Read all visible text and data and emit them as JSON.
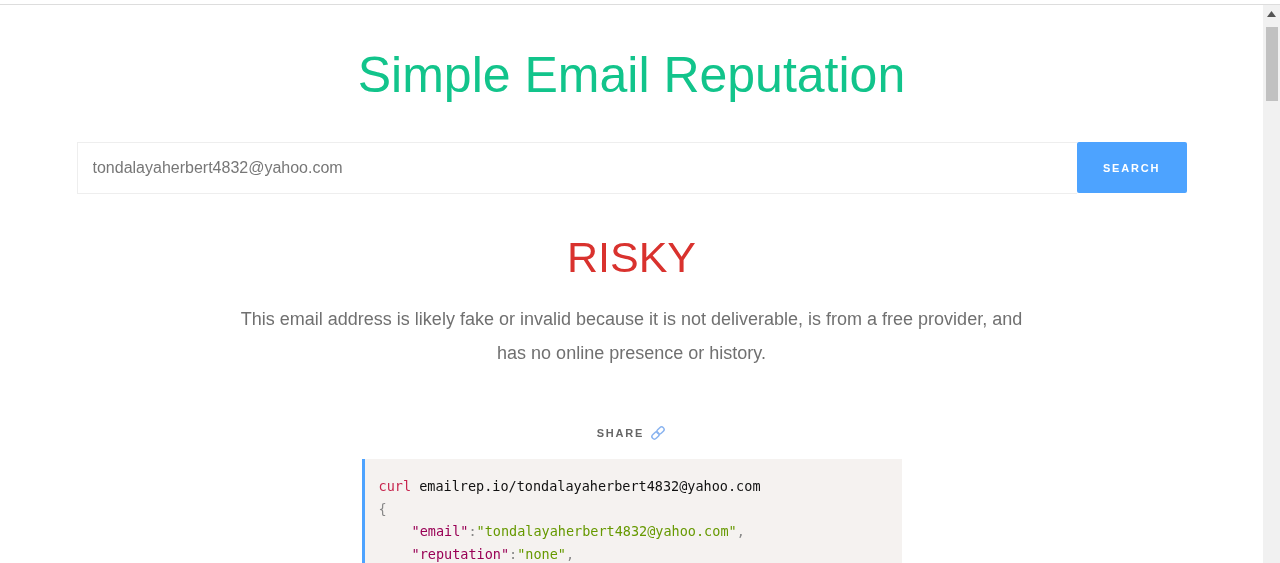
{
  "title": "Simple Email Reputation",
  "search": {
    "value": "tondalayaherbert4832@yahoo.com",
    "button": "SEARCH"
  },
  "verdict": {
    "label": "RISKY",
    "kind": "risky"
  },
  "summary": "This email address is likely fake or invalid because it is not deliverable, is from a free provider, and has no online presence or history.",
  "share": {
    "label": "SHARE"
  },
  "code": {
    "command": "curl",
    "target": "emailrep.io/tondalayaherbert4832@yahoo.com",
    "open": "{",
    "members": [
      {
        "key": "\"email\"",
        "separator": ":",
        "value": "\"tondalayaherbert4832@yahoo.com\"",
        "trailing": ","
      },
      {
        "key": "\"reputation\"",
        "separator": ":",
        "value": "\"none\"",
        "trailing": ","
      }
    ]
  }
}
